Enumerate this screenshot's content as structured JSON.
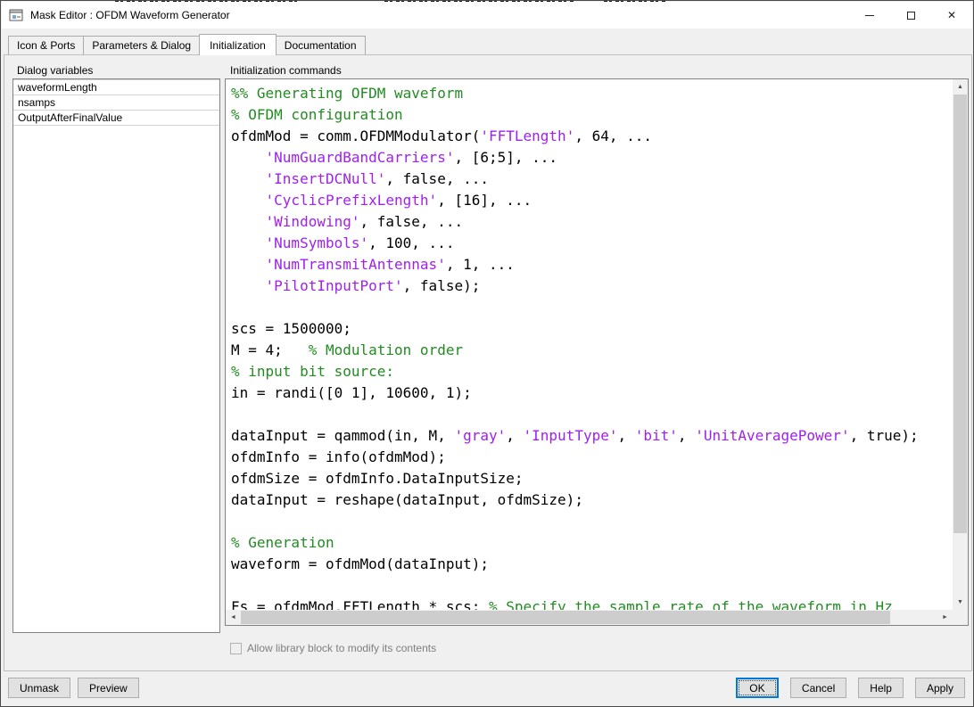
{
  "window": {
    "title": "Mask Editor : OFDM Waveform Generator"
  },
  "tabs": [
    {
      "label": "Icon & Ports",
      "active": false
    },
    {
      "label": "Parameters & Dialog",
      "active": false
    },
    {
      "label": "Initialization",
      "active": true
    },
    {
      "label": "Documentation",
      "active": false
    }
  ],
  "dialog_variables": {
    "header": "Dialog variables",
    "items": [
      "waveformLength",
      "nsamps",
      "OutputAfterFinalValue"
    ]
  },
  "initialization": {
    "header": "Initialization commands",
    "checkbox_label": "Allow library block to modify its contents",
    "checkbox_checked": false
  },
  "code_lines": [
    [
      [
        "c",
        "%% Generating OFDM waveform"
      ]
    ],
    [
      [
        "c",
        "% OFDM configuration"
      ]
    ],
    [
      [
        "p",
        "ofdmMod = comm.OFDMModulator("
      ],
      [
        "s",
        "'FFTLength'"
      ],
      [
        "p",
        ", 64, ..."
      ]
    ],
    [
      [
        "p",
        "    "
      ],
      [
        "s",
        "'NumGuardBandCarriers'"
      ],
      [
        "p",
        ", [6;5], ..."
      ]
    ],
    [
      [
        "p",
        "    "
      ],
      [
        "s",
        "'InsertDCNull'"
      ],
      [
        "p",
        ", false, ..."
      ]
    ],
    [
      [
        "p",
        "    "
      ],
      [
        "s",
        "'CyclicPrefixLength'"
      ],
      [
        "p",
        ", [16], ..."
      ]
    ],
    [
      [
        "p",
        "    "
      ],
      [
        "s",
        "'Windowing'"
      ],
      [
        "p",
        ", false, ..."
      ]
    ],
    [
      [
        "p",
        "    "
      ],
      [
        "s",
        "'NumSymbols'"
      ],
      [
        "p",
        ", 100, ..."
      ]
    ],
    [
      [
        "p",
        "    "
      ],
      [
        "s",
        "'NumTransmitAntennas'"
      ],
      [
        "p",
        ", 1, ..."
      ]
    ],
    [
      [
        "p",
        "    "
      ],
      [
        "s",
        "'PilotInputPort'"
      ],
      [
        "p",
        ", false);"
      ]
    ],
    [],
    [
      [
        "p",
        "scs = 1500000;"
      ]
    ],
    [
      [
        "p",
        "M = 4;   "
      ],
      [
        "c",
        "% Modulation order"
      ]
    ],
    [
      [
        "c",
        "% input bit source:"
      ]
    ],
    [
      [
        "p",
        "in = randi([0 1], 10600, 1);"
      ]
    ],
    [],
    [
      [
        "p",
        "dataInput = qammod(in, M, "
      ],
      [
        "s",
        "'gray'"
      ],
      [
        "p",
        ", "
      ],
      [
        "s",
        "'InputType'"
      ],
      [
        "p",
        ", "
      ],
      [
        "s",
        "'bit'"
      ],
      [
        "p",
        ", "
      ],
      [
        "s",
        "'UnitAveragePower'"
      ],
      [
        "p",
        ", true);"
      ]
    ],
    [
      [
        "p",
        "ofdmInfo = info(ofdmMod);"
      ]
    ],
    [
      [
        "p",
        "ofdmSize = ofdmInfo.DataInputSize;"
      ]
    ],
    [
      [
        "p",
        "dataInput = reshape(dataInput, ofdmSize);"
      ]
    ],
    [],
    [
      [
        "c",
        "% Generation"
      ]
    ],
    [
      [
        "p",
        "waveform = ofdmMod(dataInput);"
      ]
    ],
    [],
    [
      [
        "p",
        "Fs = ofdmMod.FFTLength * scs; "
      ],
      [
        "c",
        "% Specify the sample rate of the waveform in Hz"
      ]
    ]
  ],
  "footer": {
    "left_buttons": [
      "Unmask",
      "Preview"
    ],
    "right_buttons": [
      "OK",
      "Cancel",
      "Help",
      "Apply"
    ],
    "default_button": "OK"
  },
  "scrollbar_glyphs": {
    "up": "▲",
    "down": "▼",
    "left": "◄",
    "right": "►"
  },
  "colors": {
    "comment": "#228B22",
    "string": "#A020F0",
    "code": "#000000",
    "accent": "#0078D7"
  }
}
